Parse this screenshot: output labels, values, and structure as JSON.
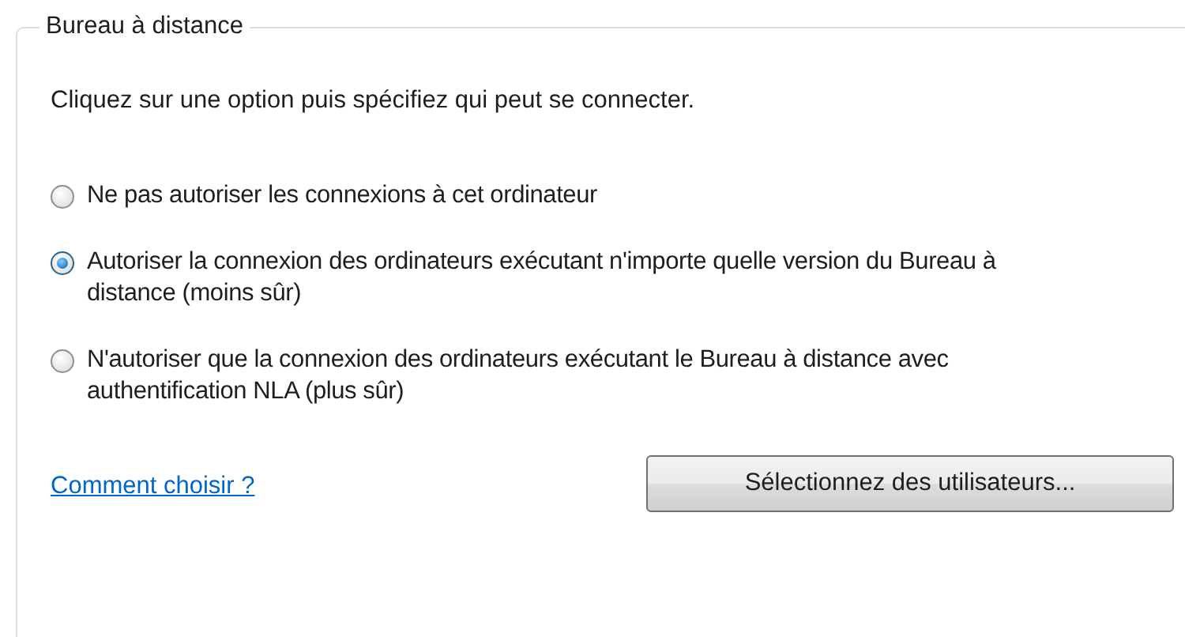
{
  "group": {
    "title": "Bureau à distance"
  },
  "instruction": "Cliquez sur une option puis spécifiez qui peut se connecter.",
  "options": [
    {
      "label": "Ne pas autoriser les connexions à cet ordinateur",
      "selected": false
    },
    {
      "label": "Autoriser la connexion des ordinateurs exécutant n'importe quelle version du Bureau à distance (moins sûr)",
      "selected": true
    },
    {
      "label": "N'autoriser que la connexion des ordinateurs exécutant le Bureau à distance avec authentification NLA (plus sûr)",
      "selected": false
    }
  ],
  "help_link": "Comment choisir ?",
  "button": "Sélectionnez des utilisateurs..."
}
